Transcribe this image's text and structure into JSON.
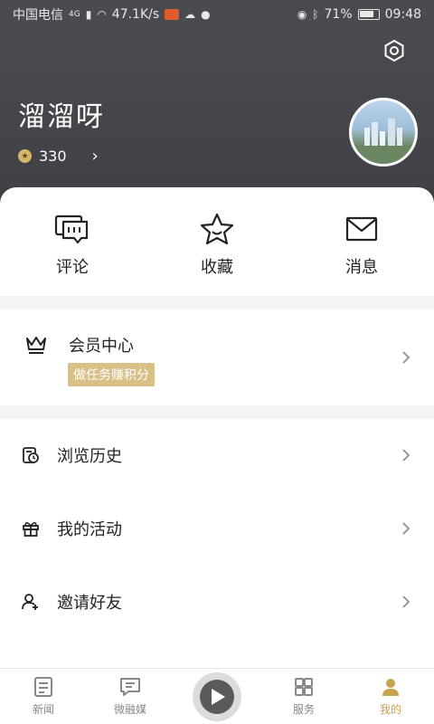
{
  "status_bar": {
    "carrier": "中国电信",
    "network": "4G",
    "speed": "47.1K/s",
    "battery": "71%",
    "time": "09:48"
  },
  "header": {
    "user_name": "溜溜呀",
    "points": "330"
  },
  "quick_actions": [
    {
      "label": "评论",
      "icon": "comment-icon"
    },
    {
      "label": "收藏",
      "icon": "star-icon"
    },
    {
      "label": "消息",
      "icon": "mail-icon"
    }
  ],
  "member": {
    "title": "会员中心",
    "tag": "做任务赚积分"
  },
  "list": [
    {
      "label": "浏览历史",
      "icon": "history-icon"
    },
    {
      "label": "我的活动",
      "icon": "gift-icon"
    },
    {
      "label": "邀请好友",
      "icon": "add-friend-icon"
    }
  ],
  "bottom_nav": [
    {
      "label": "新闻",
      "icon": "news-icon"
    },
    {
      "label": "微融媒",
      "icon": "chat-icon"
    },
    {
      "label": "",
      "icon": "play-icon"
    },
    {
      "label": "服务",
      "icon": "service-icon"
    },
    {
      "label": "我的",
      "icon": "profile-icon"
    }
  ],
  "colors": {
    "header_bg": "#4a4b50",
    "accent_gold": "#d9c087",
    "active_nav": "#c9a24e"
  }
}
